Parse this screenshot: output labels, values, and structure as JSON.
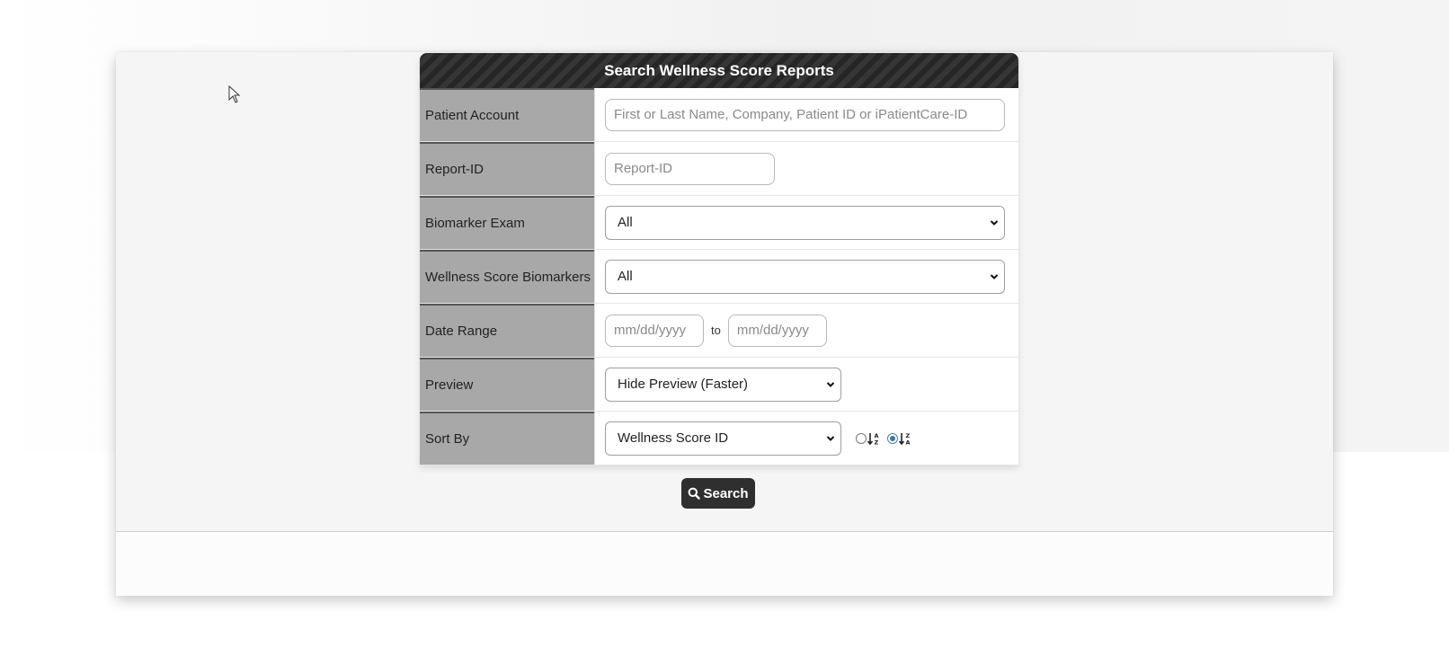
{
  "form": {
    "title": "Search Wellness Score Reports",
    "patient_account": {
      "label": "Patient Account",
      "placeholder": "First or Last Name, Company, Patient ID or iPatientCare-ID"
    },
    "report_id": {
      "label": "Report-ID",
      "placeholder": "Report-ID"
    },
    "biomarker_exam": {
      "label": "Biomarker Exam",
      "value": "All"
    },
    "wellness_biomarkers": {
      "label": "Wellness Score Biomarkers",
      "value": "All"
    },
    "date_range": {
      "label": "Date Range",
      "from_placeholder": "mm/dd/yyyy",
      "to_label": "to",
      "to_placeholder": "mm/dd/yyyy"
    },
    "preview": {
      "label": "Preview",
      "value": "Hide Preview (Faster)"
    },
    "sort_by": {
      "label": "Sort By",
      "value": "Wellness Score ID",
      "ascending_selected": false,
      "descending_selected": true,
      "ascending_icon": "sort-alpha-ascending-icon",
      "descending_icon": "sort-alpha-descending-icon"
    }
  },
  "search_button": {
    "label": "Search",
    "icon": "search-icon"
  },
  "colors": {
    "header_bg": "#2c2c2c",
    "label_bg": "#a8a8a8",
    "button_bg": "#2f2f2f",
    "radio_accent": "#3b73a8"
  }
}
